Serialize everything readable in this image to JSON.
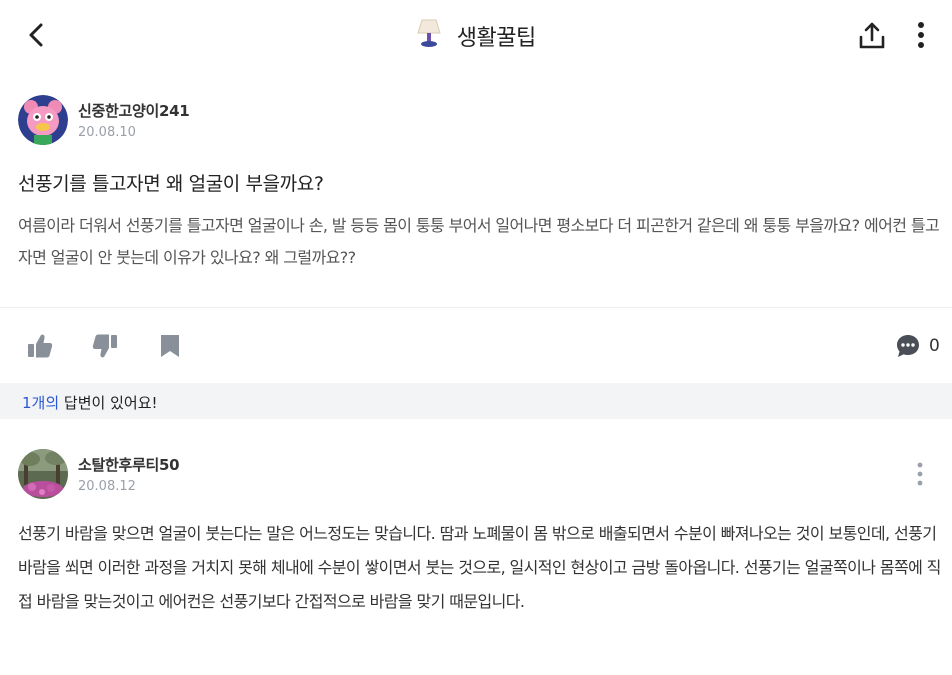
{
  "header": {
    "title": "생활꿀팁",
    "back_icon": "chevron-left-icon",
    "share_icon": "share-icon",
    "more_icon": "more-vertical-icon"
  },
  "question": {
    "author": "신중한고양이241",
    "date": "20.08.10",
    "title": "선풍기를 틀고자면 왜 얼굴이 부을까요?",
    "body": "여름이라 더워서 선풍기를 틀고자면 얼굴이나 손, 발 등등 몸이 퉁퉁 부어서 일어나면 평소보다 더 피곤한거 같은데 왜 퉁퉁 부을까요? 에어컨 틀고 자면 얼굴이 안 붓는데 이유가 있나요? 왜 그럴까요??"
  },
  "actions": {
    "comment_count": "0"
  },
  "answers_bar": {
    "count_text": "1개의",
    "suffix_text": " 답변이 있어요!"
  },
  "answer": {
    "author": "소탈한후루티50",
    "date": "20.08.12",
    "body": "선풍기 바람을 맞으면 얼굴이 붓는다는 말은 어느정도는 맞습니다. 땀과 노폐물이 몸 밖으로 배출되면서 수분이 빠져나오는 것이 보통인데, 선풍기 바람을 쐬면 이러한 과정을 거치지 못해 체내에 수분이 쌓이면서 붓는 것으로, 일시적인 현상이고 금방 돌아옵니다.  선풍기는 얼굴쪽이나 몸쪽에 직접 바람을 맞는것이고 에어컨은 선풍기보다 간접적으로 바람을 맞기 때문입니다."
  },
  "colors": {
    "accent": "#2b59d6",
    "icon_gray": "#8a9099",
    "bar_bg": "#f3f4f6"
  }
}
